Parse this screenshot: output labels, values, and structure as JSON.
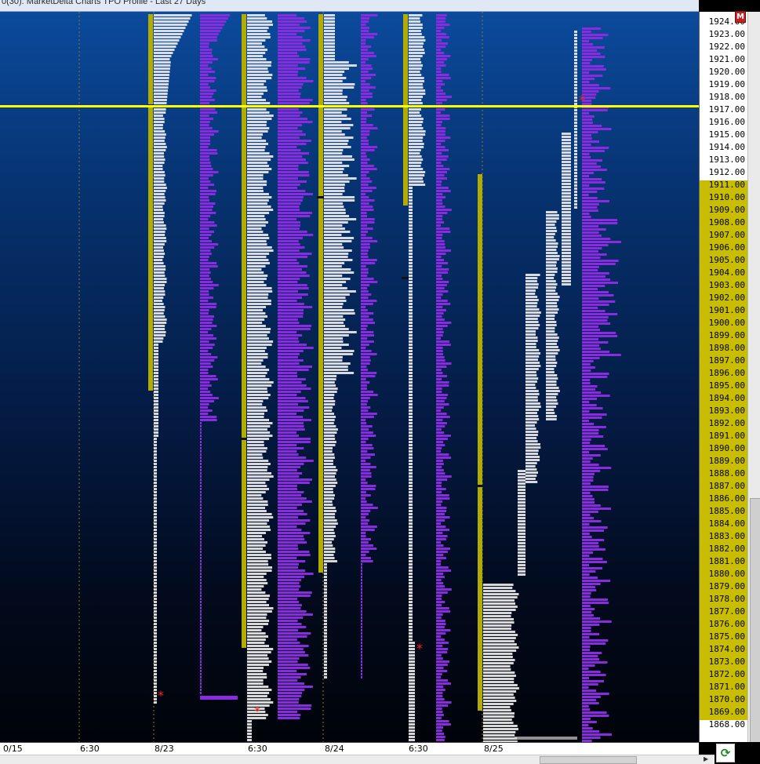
{
  "window": {
    "title": "0(30): MarketDelta Charts TPO Profile - Last 27 Days",
    "m_button": "M"
  },
  "price_axis": {
    "labels": [
      "1924.00",
      "1923.00",
      "1922.00",
      "1921.00",
      "1920.00",
      "1919.00",
      "1918.00",
      "1917.00",
      "1916.00",
      "1915.00",
      "1914.00",
      "1913.00",
      "1912.00",
      "1911.00",
      "1910.00",
      "1909.00",
      "1908.00",
      "1907.00",
      "1906.00",
      "1905.00",
      "1904.00",
      "1903.00",
      "1902.00",
      "1901.00",
      "1900.00",
      "1899.00",
      "1898.00",
      "1897.00",
      "1896.00",
      "1895.00",
      "1894.00",
      "1893.00",
      "1892.00",
      "1891.00",
      "1890.00",
      "1889.00",
      "1888.00",
      "1887.00",
      "1886.00",
      "1885.00",
      "1884.00",
      "1883.00",
      "1882.00",
      "1881.00",
      "1880.00",
      "1879.00",
      "1878.00",
      "1877.00",
      "1876.00",
      "1875.00",
      "1874.00",
      "1873.00",
      "1872.00",
      "1871.00",
      "1870.00",
      "1869.00",
      "1868.00"
    ],
    "value_area_high": 1911,
    "value_area_low": 1869,
    "current_price": 1917.25
  },
  "time_axis": {
    "labels": [
      "0/15",
      "6:30",
      "8/23",
      "6:30",
      "8/24",
      "6:30",
      "8/25"
    ]
  },
  "colors": {
    "tpo": "#e8e8e8",
    "volume": "#8a2be2",
    "value_area": "#b3ac00",
    "price_line": "#ffff00",
    "marker": "#ff2020"
  },
  "icons": {
    "refresh": "refresh-icon"
  },
  "chart_data": {
    "type": "market-profile",
    "y_range": [
      1867.5,
      1924.5
    ],
    "price_line": 1917.25,
    "sessions": [
      {
        "va_high": 1924,
        "va_low": 1896,
        "poc": 1917,
        "tpo_low": 1870,
        "tpo_high": 1924
      },
      {
        "va_high": 1924,
        "va_low": 1874,
        "poc": 1890,
        "tpo_low": 1869,
        "tpo_high": 1924
      },
      {
        "va_high": 1924,
        "va_low": 1881,
        "poc": 1909,
        "tpo_low": 1873,
        "tpo_high": 1924
      },
      {
        "va_high": 1924,
        "va_low": 1908,
        "poc": 1904,
        "tpo_low": 1868,
        "tpo_high": 1924
      },
      {
        "va_high": 1912,
        "va_low": 1870,
        "poc": 1887,
        "tpo_low": 1868,
        "tpo_high": 1924
      }
    ]
  }
}
